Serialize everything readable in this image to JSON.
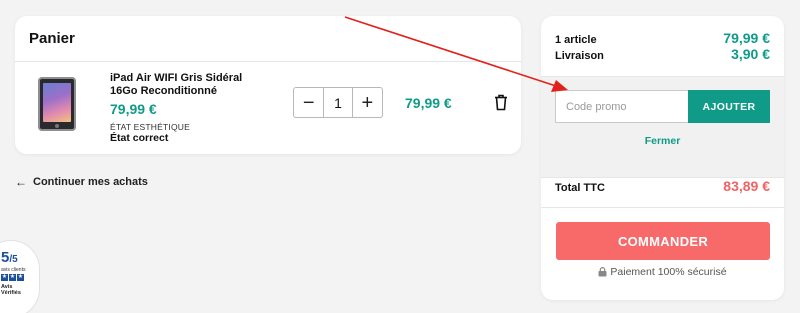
{
  "cart": {
    "title": "Panier",
    "item": {
      "name": "iPad Air WIFI Gris Sidéral 16Go Reconditionné",
      "unit_price": "79,99 €",
      "condition_label": "ÉTAT ESTHÉTIQUE",
      "condition_value": "État correct",
      "quantity": "1",
      "minus_symbol": "−",
      "plus_symbol": "+",
      "line_total": "79,99 €",
      "image_icon": "ipad-thumbnail",
      "delete_icon": "trash-icon"
    },
    "continue_link": "Continuer mes achats",
    "continue_arrow": "←"
  },
  "summary": {
    "items_label": "1 article",
    "items_value": "79,99 €",
    "shipping_label": "Livraison",
    "shipping_value": "3,90 €",
    "promo_placeholder": "Code promo",
    "promo_button": "AJOUTER",
    "promo_close": "Fermer",
    "total_label": "Total TTC",
    "total_value": "83,89 €",
    "order_button": "COMMANDER",
    "secure_note": "Paiement 100% sécurisé",
    "secure_icon": "lock-icon"
  },
  "badge": {
    "score": "5",
    "score_suffix": "/5",
    "subtitle": "avis clients",
    "brand_line1": "Avis",
    "brand_line2": "Vérifiés"
  },
  "colors": {
    "accent": "#0f9b87",
    "cta": "#f86a6a",
    "total": "#f06363",
    "annotation": "#e3211c"
  }
}
